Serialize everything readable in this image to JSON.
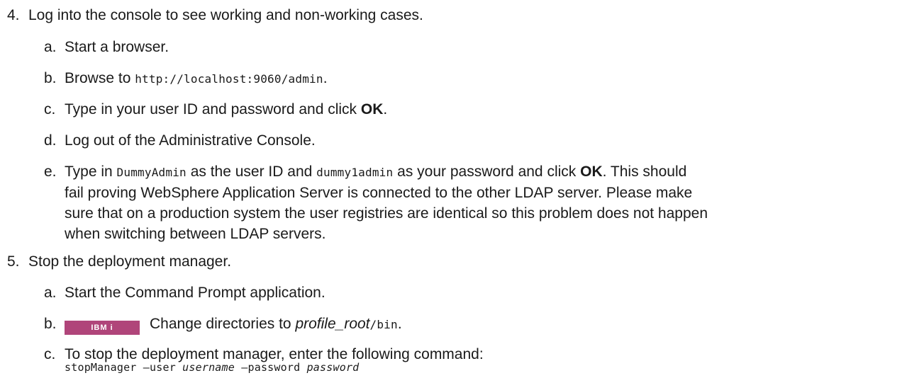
{
  "steps": [
    {
      "number": "4.",
      "text": "Log into the console to see working and non-working cases.",
      "substeps": [
        {
          "letter": "a.",
          "text": "Start a browser."
        },
        {
          "letter": "b.",
          "pre": "Browse to ",
          "code": "http://localhost:9060/admin",
          "post": "."
        },
        {
          "letter": "c.",
          "pre": "Type in your user ID and password and click ",
          "bold": "OK",
          "post": "."
        },
        {
          "letter": "d.",
          "text": "Log out of the Administrative Console."
        },
        {
          "letter": "e.",
          "pre": "Type in ",
          "code1": "DummyAdmin",
          "mid": " as the user ID and ",
          "code2": "dummy1admin",
          "mid2": " as your password and click ",
          "bold": "OK",
          "post": ". This should",
          "line2": "fail proving WebSphere Application Server is connected to the other LDAP server. Please make",
          "line3": "sure that on a production system the user registries are identical so this problem does not happen",
          "line4": "when switching between LDAP servers."
        }
      ]
    },
    {
      "number": "5.",
      "text": "Stop the deployment manager.",
      "substeps": [
        {
          "letter": "a.",
          "text": "Start the Command Prompt application."
        },
        {
          "letter": "b.",
          "badge": "IBM i",
          "pre": "Change directories to ",
          "italic": "profile_root",
          "code": "/bin",
          "post": "."
        },
        {
          "letter": "c.",
          "text": "To stop the deployment manager, enter the following command:"
        }
      ]
    }
  ],
  "command": {
    "part1": "stopManager –user ",
    "username": "username",
    "part2": " –password ",
    "password": "password"
  }
}
